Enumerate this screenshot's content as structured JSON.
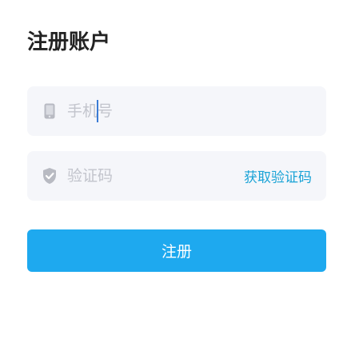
{
  "page": {
    "title": "注册账户"
  },
  "phone_field": {
    "icon": "phone-icon",
    "placeholder": "手机号",
    "value": ""
  },
  "code_field": {
    "icon": "shield-check-icon",
    "placeholder": "验证码",
    "value": "",
    "get_code_label": "获取验证码"
  },
  "submit": {
    "label": "注册"
  },
  "colors": {
    "accent": "#1ea9ef",
    "link": "#1aa3d6",
    "field_background": "#f5f6fa",
    "placeholder": "#c2c4cc",
    "icon": "#b8bac2"
  }
}
